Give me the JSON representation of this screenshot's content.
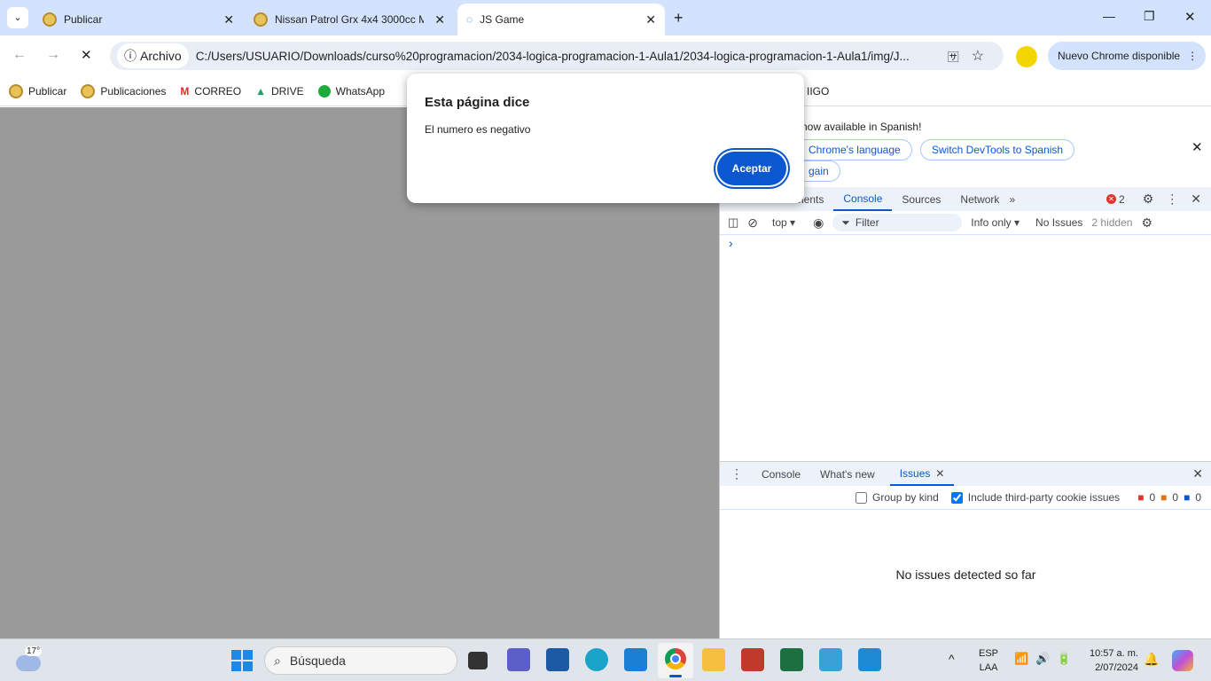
{
  "tabs": [
    {
      "title": "Publicar",
      "active": false
    },
    {
      "title": "Nissan Patrol Grx 4x4 3000cc M",
      "active": false
    },
    {
      "title": "JS Game",
      "active": true
    }
  ],
  "toolbar": {
    "security_label": "Archivo",
    "url": "C:/Users/USUARIO/Downloads/curso%20programacion/2034-logica-programacion-1-Aula1/2034-logica-programacion-1-Aula1/img/J...",
    "update_label": "Nuevo Chrome disponible"
  },
  "bookmarks": [
    {
      "label": "Publicar"
    },
    {
      "label": "Publicaciones"
    },
    {
      "label": "CORREO"
    },
    {
      "label": "DRIVE"
    },
    {
      "label": "WhatsApp"
    },
    {
      "label": "IIGO"
    }
  ],
  "dialog": {
    "title": "Esta página dice",
    "message": "El numero es negativo",
    "ok_label": "Aceptar"
  },
  "devtools": {
    "banner": {
      "text": "now available in Spanish!",
      "btn_match": "Chrome's language",
      "btn_switch": "Switch DevTools to Spanish",
      "btn_again": "gain"
    },
    "tabs": [
      "ements",
      "Console",
      "Sources",
      "Network"
    ],
    "active_tab": "Console",
    "error_count": "2",
    "console_toolbar": {
      "context": "top",
      "filter_placeholder": "Filter",
      "level": "Info only",
      "issues": "No Issues",
      "hidden": "2 hidden"
    },
    "prompt": "›",
    "drawer": {
      "tabs": [
        "Console",
        "What's new",
        "Issues"
      ],
      "active_tab": "Issues",
      "group_by_kind": "Group by kind",
      "group_by_kind_checked": false,
      "third_party": "Include third-party cookie issues",
      "third_party_checked": true,
      "counts": {
        "errors": "0",
        "warnings": "0",
        "info": "0"
      },
      "empty": "No issues detected so far"
    }
  },
  "taskbar": {
    "weather": "17°",
    "search_placeholder": "Búsqueda",
    "lang1": "ESP",
    "lang2": "LAA",
    "time": "10:57 a. m.",
    "date": "2/07/2024"
  },
  "colors": {
    "accent": "#0b57d0",
    "tabbar": "#d3e3fd",
    "page": "#9a9a9a"
  }
}
